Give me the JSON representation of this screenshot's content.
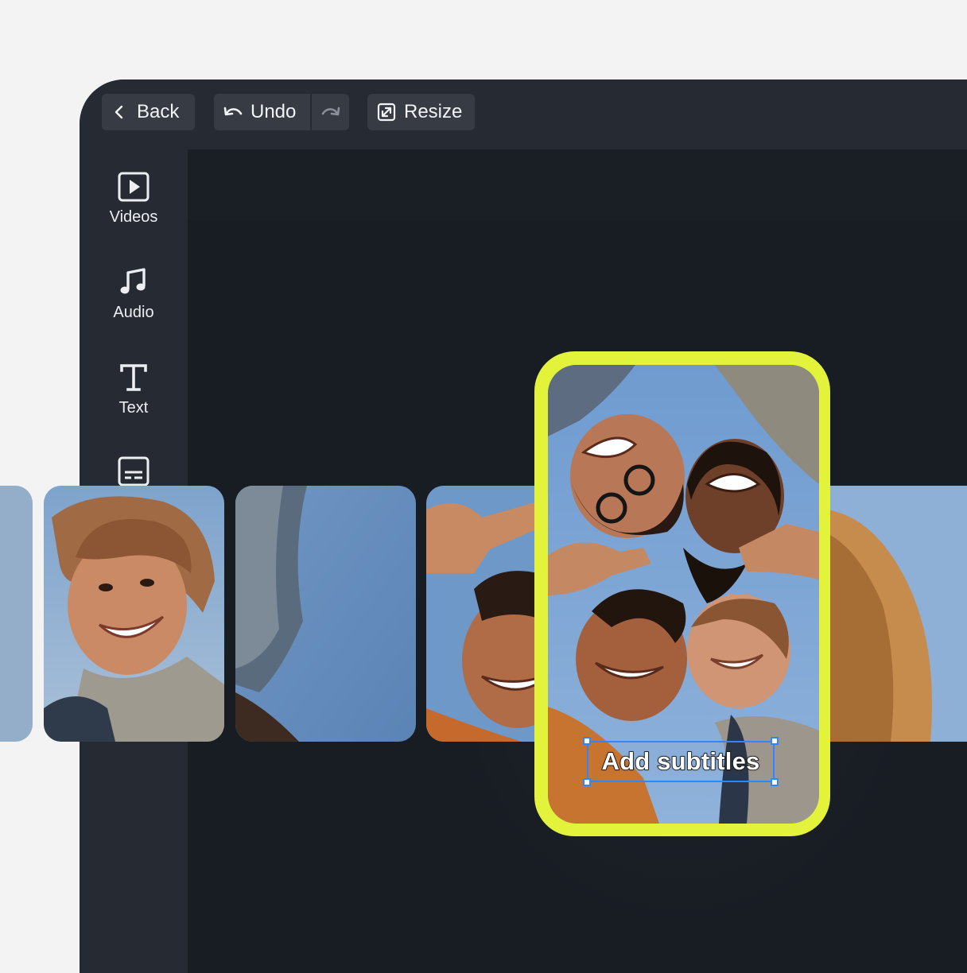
{
  "toolbar": {
    "back_label": "Back",
    "undo_label": "Undo",
    "resize_label": "Resize"
  },
  "sidebar": {
    "items": [
      {
        "label": "Videos",
        "icon": "play-square-icon"
      },
      {
        "label": "Audio",
        "icon": "music-note-icon"
      },
      {
        "label": "Text",
        "icon": "text-t-icon"
      },
      {
        "label": "",
        "icon": "subtitles-icon"
      }
    ]
  },
  "canvas": {
    "subtitle_text": "Add subtitles"
  },
  "colors": {
    "accent_selection": "#e3f23a",
    "handle_blue": "#2f86ff",
    "app_bg": "#181c23",
    "panel_bg": "#262a32"
  }
}
